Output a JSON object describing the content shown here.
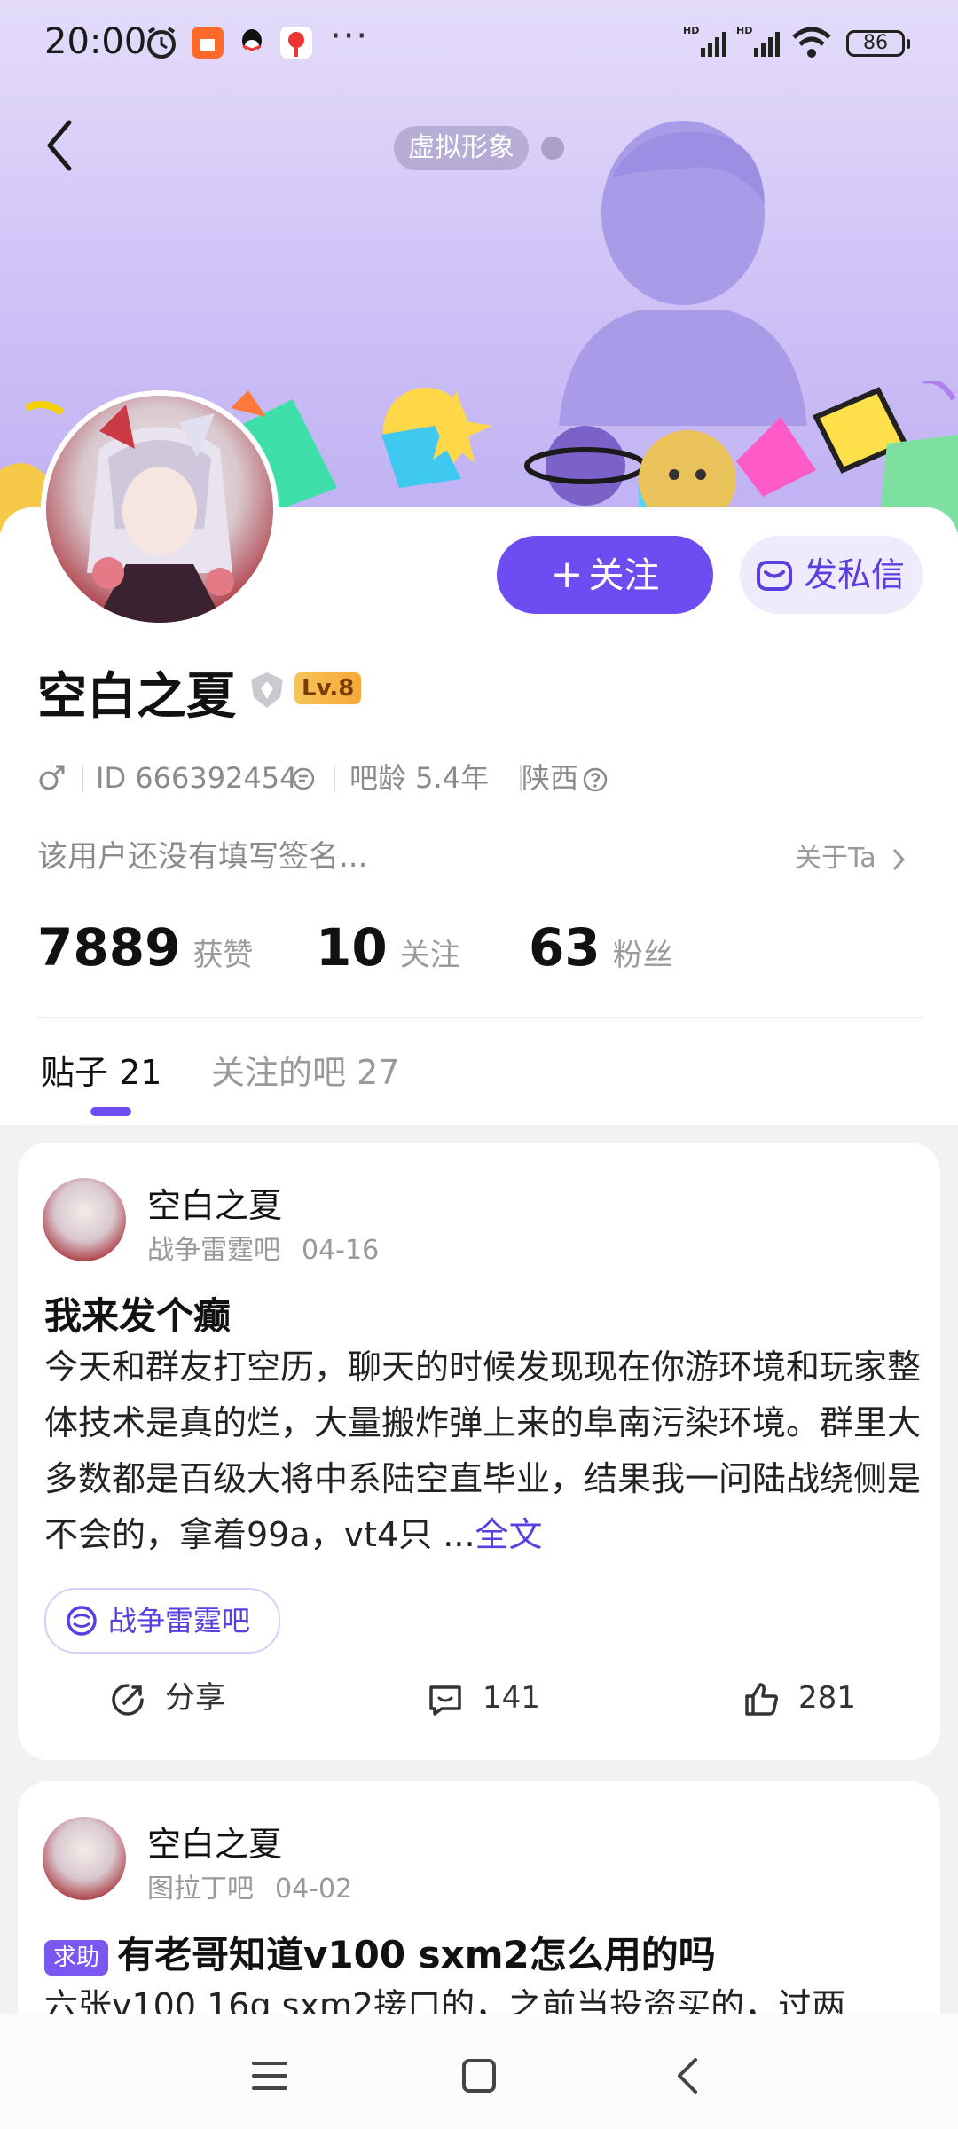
{
  "status_bar": {
    "time": "20:00",
    "more": "···",
    "battery": "86",
    "icons": [
      "alarm-icon",
      "shopping-app-icon",
      "qq-app-icon",
      "map-app-icon",
      "signal-hd-icon",
      "signal-hd-icon",
      "wifi-icon",
      "battery-icon"
    ]
  },
  "header": {
    "back_icon": "back-chevron-icon",
    "avatar_pill": "虚拟形象"
  },
  "profile": {
    "username": "空白之夏",
    "level": "Lv.8",
    "gender_icon": "male-icon",
    "id_text": "ID 666392454",
    "bar_age": "吧龄 5.4年",
    "location": "陕西",
    "signature": "该用户还没有填写签名...",
    "about": "关于Ta",
    "follow_label": "关注",
    "dm_label": "发私信"
  },
  "stats": [
    {
      "value": "7889",
      "label": "获赞"
    },
    {
      "value": "10",
      "label": "关注"
    },
    {
      "value": "63",
      "label": "粉丝"
    }
  ],
  "tabs": [
    {
      "label": "贴子 21",
      "active": true
    },
    {
      "label": "关注的吧 27",
      "active": false
    }
  ],
  "posts": [
    {
      "author": "空白之夏",
      "forum": "战争雷霆吧",
      "date": "04-16",
      "title": "我来发个癫",
      "body": "今天和群友打空历，聊天的时候发现现在你游环境和玩家整体技术是真的烂，大量搬炸弹上来的阜南污染环境。群里大多数都是百级大将中系陆空直毕业，结果我一问陆战绕侧是不会的，拿着99a，vt4只 ...",
      "more": "全文",
      "forum_chip": "战争雷霆吧",
      "share": "分享",
      "comments": "141",
      "likes": "281"
    },
    {
      "author": "空白之夏",
      "forum": "图拉丁吧",
      "date": "04-02",
      "tag": "求助",
      "title": "有老哥知道v100 sxm2怎么用的吗",
      "body": "六张v100 16g sxm2接口的，之前当投资买的，过两"
    }
  ],
  "nav": {
    "menu_icon": "menu-icon",
    "home_icon": "home-square-icon",
    "back_icon": "back-triangle-icon"
  }
}
